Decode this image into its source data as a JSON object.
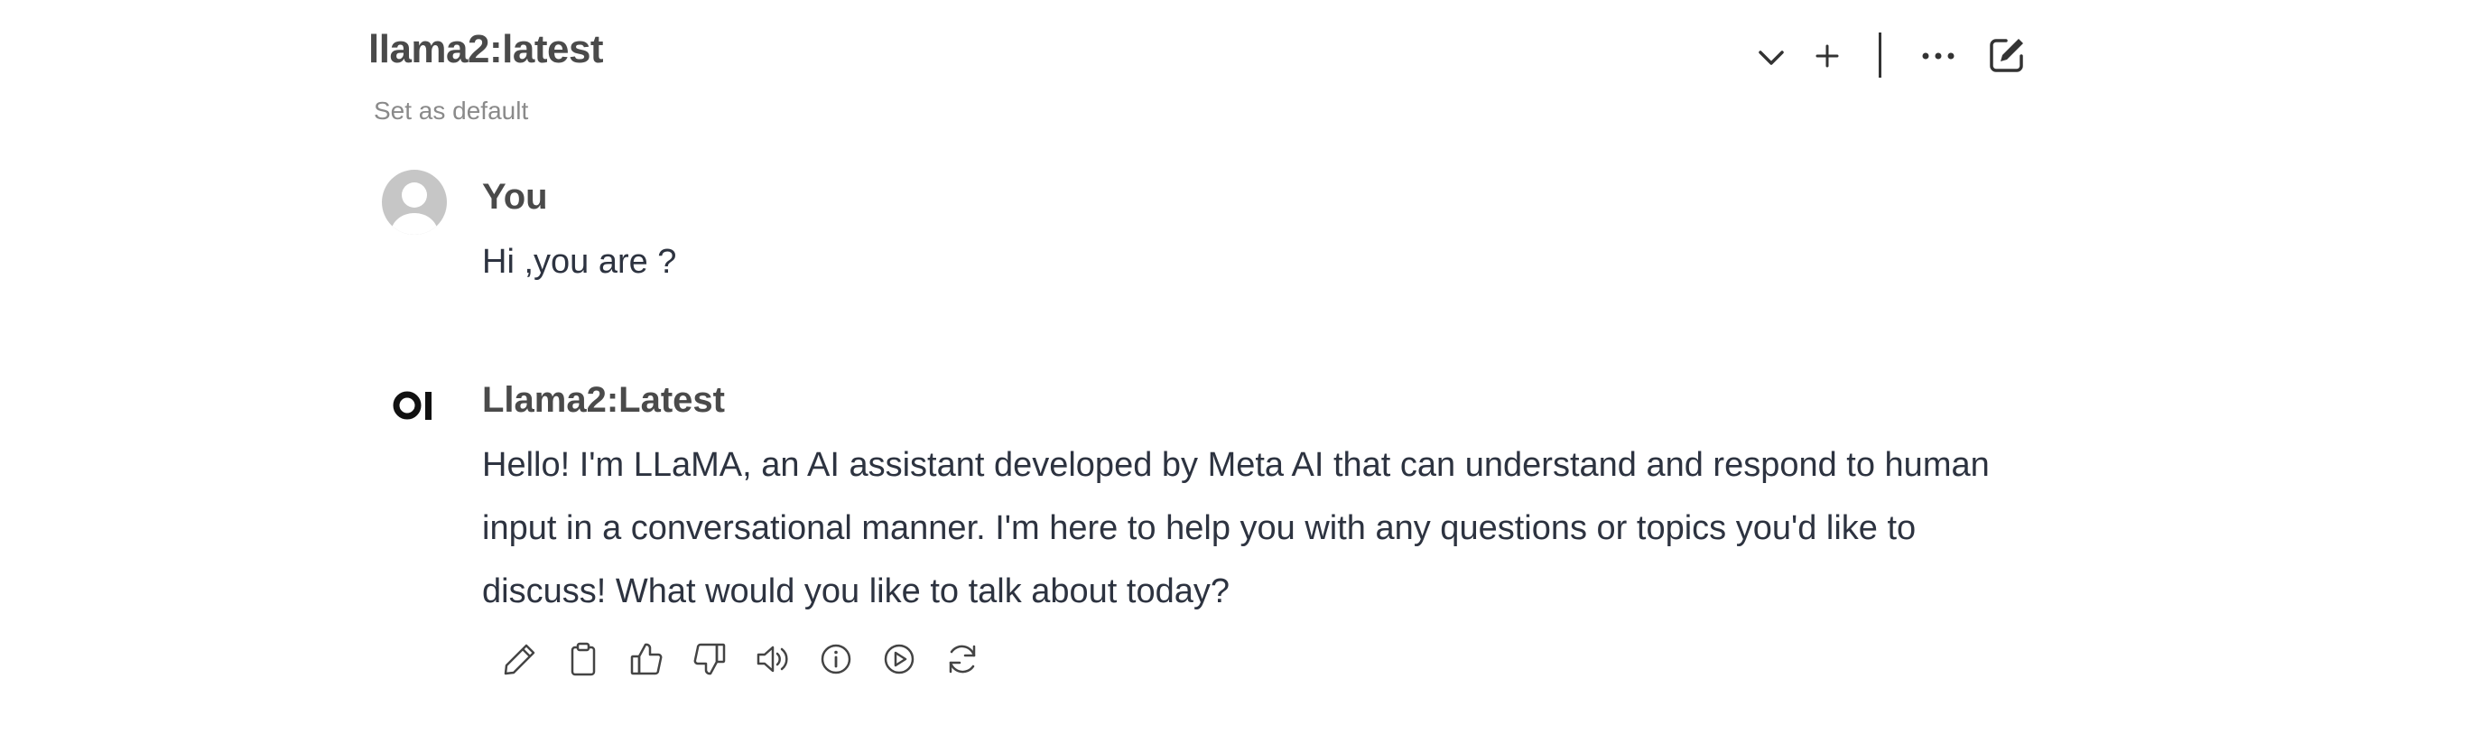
{
  "header": {
    "model_name": "llama2:latest",
    "set_default_label": "Set as default",
    "icons": [
      "chevron-down-icon",
      "plus-icon",
      "more-horizontal-icon",
      "edit-icon"
    ]
  },
  "messages": [
    {
      "sender": "You",
      "avatar": "user-avatar",
      "text": "Hi ,you are ?"
    },
    {
      "sender": "Llama2:Latest",
      "avatar": "open-webui-logo",
      "text": "Hello! I'm LLaMA, an AI assistant developed by Meta AI that can understand and respond to human input in a conversational manner. I'm here to help you with any questions or topics you'd like to discuss! What would you like to talk about today?"
    }
  ],
  "message_actions": [
    "edit-icon",
    "copy-icon",
    "thumbs-up-icon",
    "thumbs-down-icon",
    "read-aloud-icon",
    "info-icon",
    "continue-icon",
    "regenerate-icon"
  ],
  "colors": {
    "text": "#2d3340",
    "heading": "#4a4a4a",
    "muted": "#8a8a8a",
    "avatar_bg": "#c6c6c6"
  }
}
